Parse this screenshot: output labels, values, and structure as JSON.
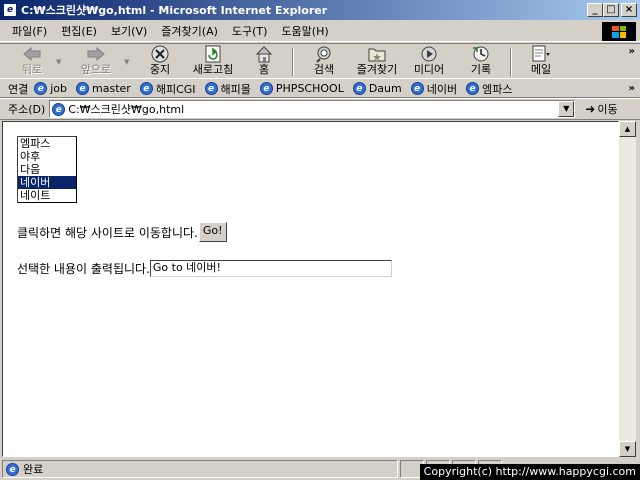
{
  "window": {
    "title": "C:₩스크린샷₩go,html - Microsoft Internet Explorer",
    "min_glyph": "_",
    "max_glyph": "□",
    "close_glyph": "×"
  },
  "menu": [
    "파일(F)",
    "편집(E)",
    "보기(V)",
    "즐겨찾기(A)",
    "도구(T)",
    "도움말(H)"
  ],
  "toolbar": {
    "back": "뒤로",
    "forward": "앞으로",
    "stop": "중지",
    "refresh": "새로고침",
    "home": "홈",
    "search": "검색",
    "favorites": "즐겨찾기",
    "media": "미디어",
    "history": "기록",
    "mail": "메일",
    "more": "»"
  },
  "links": {
    "label": "연결",
    "items": [
      "job",
      "master",
      "해피CGI",
      "해피몰",
      "PHPSCHOOL",
      "Daum",
      "네이버",
      "엠파스"
    ],
    "more": "»"
  },
  "address": {
    "label": "주소(D)",
    "value": "C:₩스크린샷₩go,html",
    "go_label": "이동"
  },
  "page": {
    "sites": [
      {
        "label": "엠파스",
        "selected": false
      },
      {
        "label": "야후",
        "selected": false
      },
      {
        "label": "다음",
        "selected": false
      },
      {
        "label": "네이버",
        "selected": true
      },
      {
        "label": "네이트",
        "selected": false
      }
    ],
    "instruction": "클릭하면 해당 사이트로 이동합니다.",
    "go_button": "Go!",
    "output_label": "선택한 내용이 출력됩니다.",
    "output_value": "Go to 네이버!"
  },
  "status": {
    "text": "완료",
    "copyright": "Copyright(c) http://www.happycgi.com"
  }
}
